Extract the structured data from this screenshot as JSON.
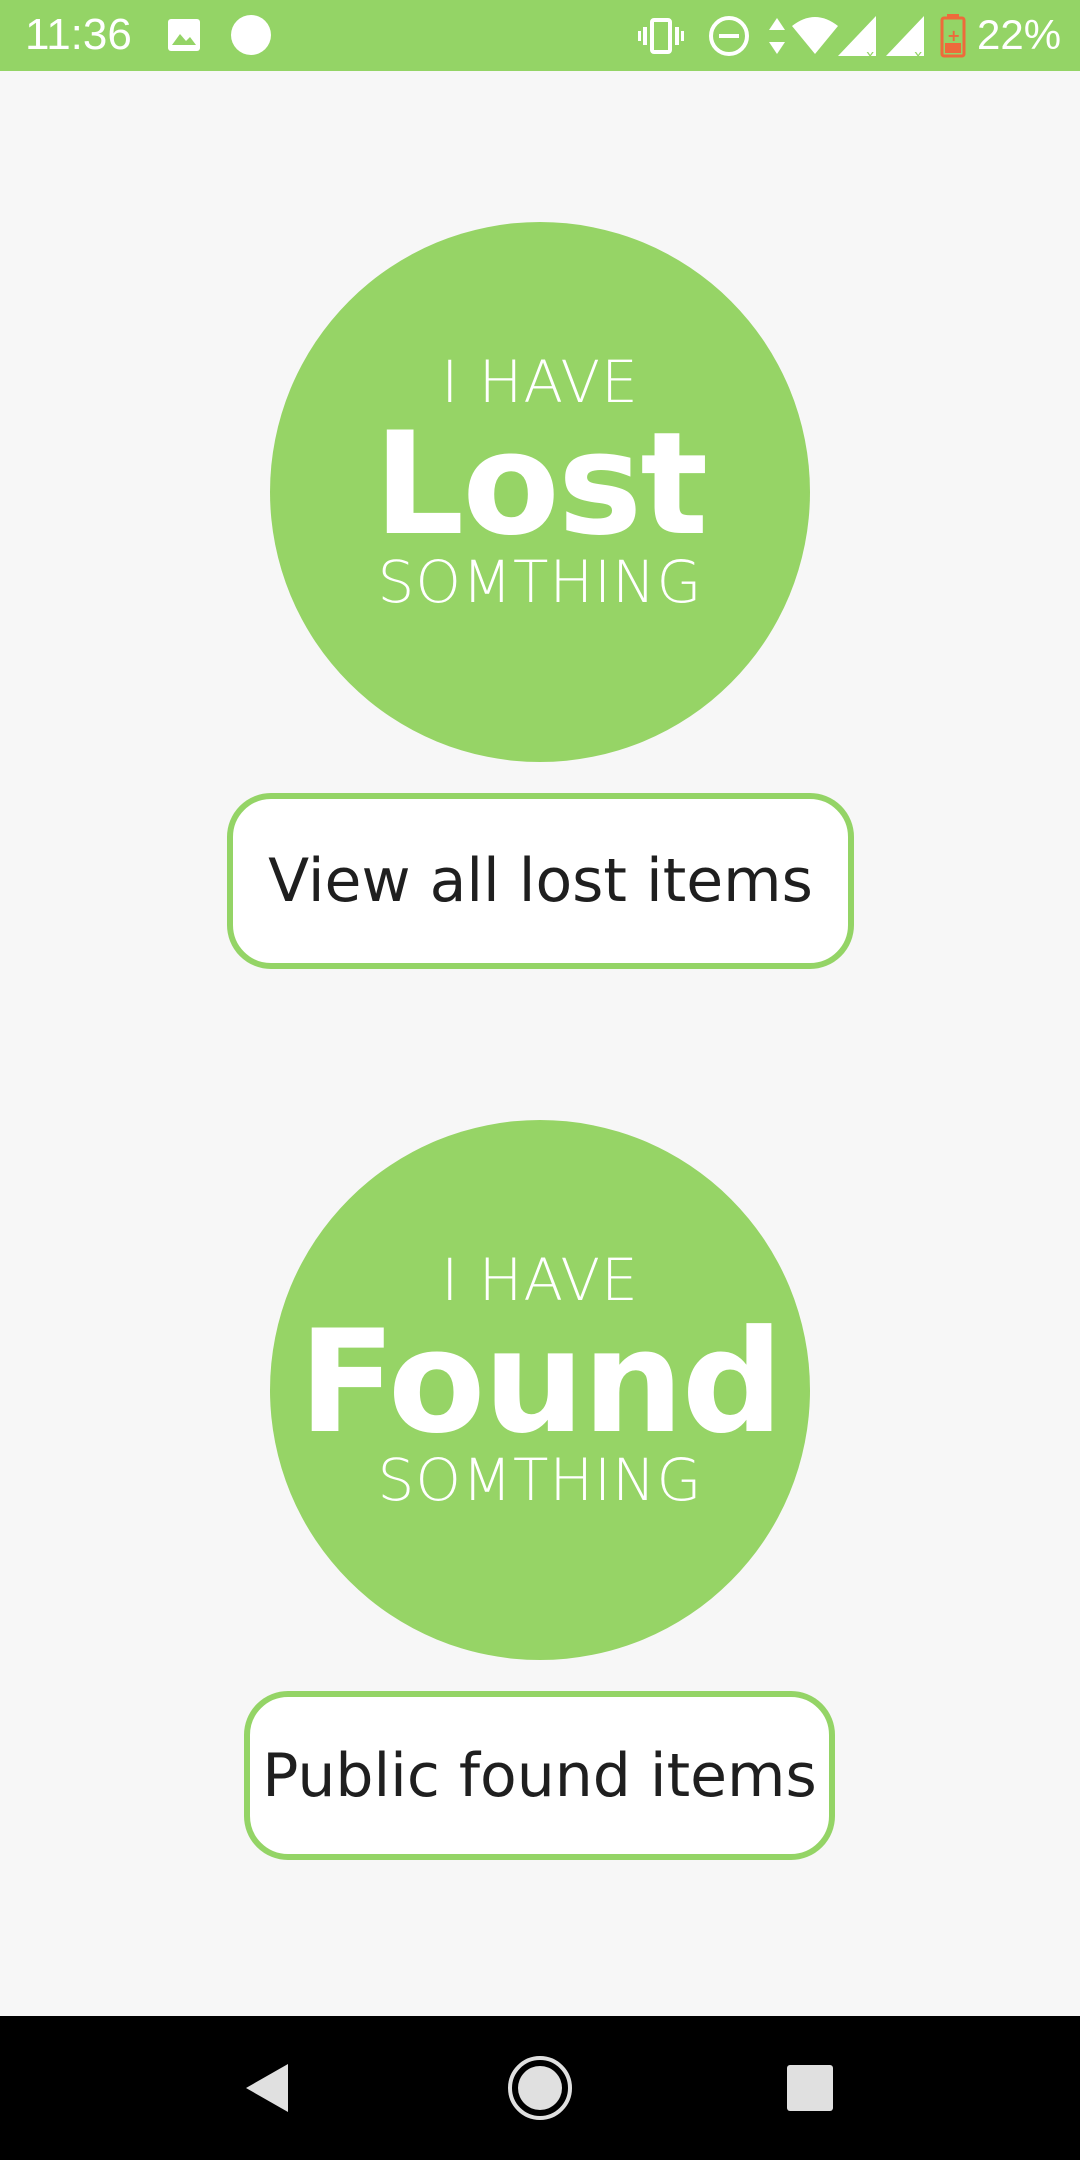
{
  "status_bar": {
    "time": "11:36",
    "battery": "22%",
    "icons": [
      "image-icon",
      "circle-icon",
      "vibrate-icon",
      "do-not-disturb-icon",
      "data-arrows-icon",
      "wifi-icon",
      "cell-signal-icon",
      "cell-signal-2-icon",
      "battery-icon"
    ],
    "background": "#94d466"
  },
  "lost_logo": {
    "top": "I HAVE",
    "main": "Lost",
    "bottom": "SOMTHING"
  },
  "lost_button": {
    "label": "View all lost items"
  },
  "found_logo": {
    "top": "I HAVE",
    "main": "Found",
    "bottom": "SOMTHING"
  },
  "found_button": {
    "label": "Public found items"
  },
  "nav_bar": {
    "icons": [
      "back-icon",
      "home-icon",
      "recents-icon"
    ]
  },
  "colors": {
    "accent": "#94d466",
    "page_background": "#f7f7f7",
    "button_text": "#1f1f1f"
  }
}
